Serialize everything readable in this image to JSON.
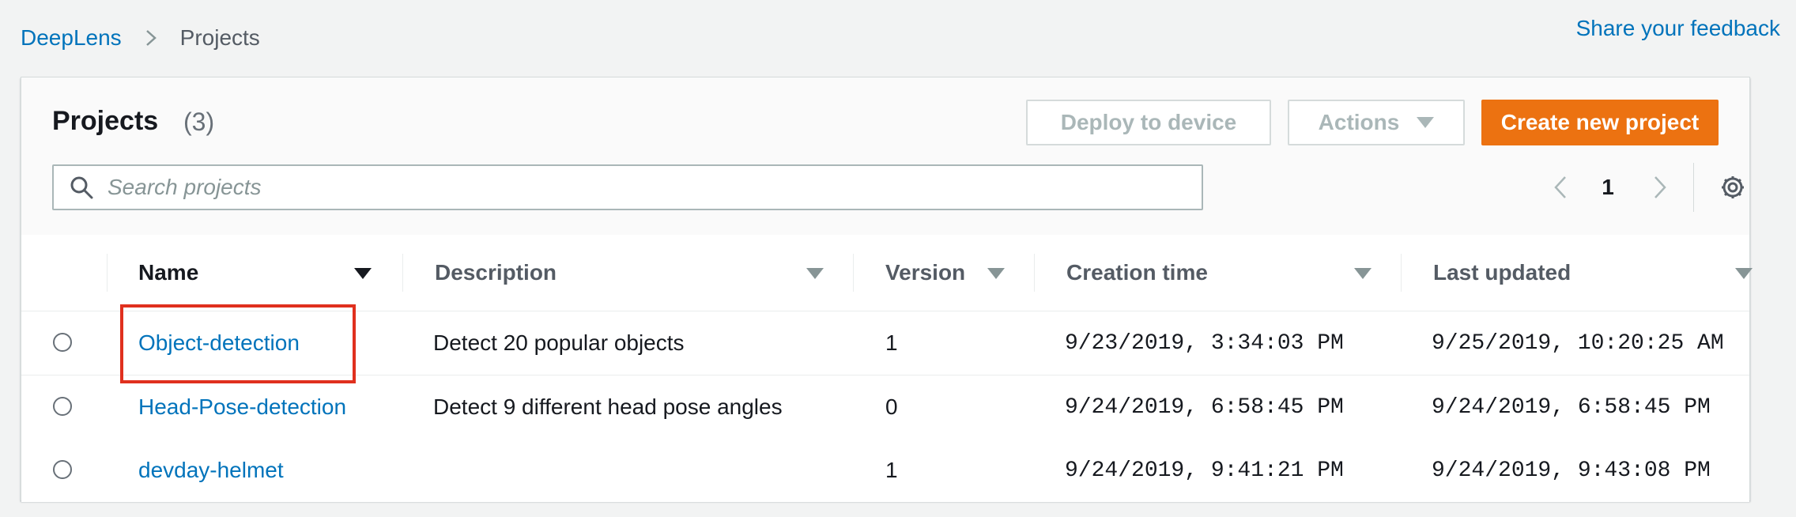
{
  "breadcrumb": {
    "root": "DeepLens",
    "current": "Projects"
  },
  "feedback_link": "Share your feedback",
  "panel": {
    "title": "Projects",
    "count": "(3)",
    "buttons": {
      "deploy": "Deploy to device",
      "actions": "Actions",
      "create": "Create new project"
    },
    "search_placeholder": "Search projects",
    "page_number": "1"
  },
  "table": {
    "columns": {
      "name": "Name",
      "description": "Description",
      "version": "Version",
      "creation_time": "Creation time",
      "last_updated": "Last updated"
    },
    "sorted_by": "Name",
    "rows": [
      {
        "name": "Object-detection",
        "description": "Detect 20 popular objects",
        "version": "1",
        "creation_time": "9/23/2019, 3:34:03 PM",
        "last_updated": "9/25/2019, 10:20:25 AM",
        "selected": false
      },
      {
        "name": "Head-Pose-detection",
        "description": "Detect 9 different head pose angles",
        "version": "0",
        "creation_time": "9/24/2019, 6:58:45 PM",
        "last_updated": "9/24/2019, 6:58:45 PM",
        "selected": false
      },
      {
        "name": "devday-helmet",
        "description": "",
        "version": "1",
        "creation_time": "9/24/2019, 9:41:21 PM",
        "last_updated": "9/24/2019, 9:43:08 PM",
        "selected": false
      }
    ]
  },
  "icons": {
    "breadcrumb_separator": "chevron-right-icon",
    "search": "search-icon",
    "pager_prev": "chevron-left-icon",
    "pager_next": "chevron-right-icon",
    "settings": "gear-icon",
    "sort": "caret-down-icon"
  },
  "colors": {
    "link": "#0073bb",
    "primary_button": "#ec7211",
    "highlight": "#e0301e",
    "background": "#f2f3f3"
  }
}
